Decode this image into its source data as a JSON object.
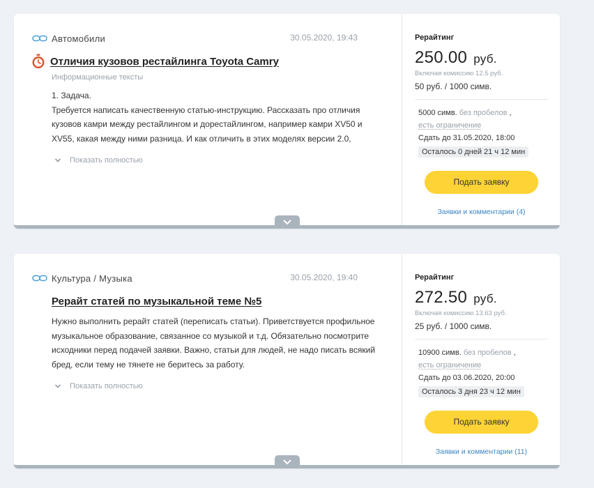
{
  "tasks": [
    {
      "category": "Автомобили",
      "date": "30.05.2020, 19:43",
      "has_timer": true,
      "title": "Отличия кузовов рестайлинга Toyota Camry",
      "subtype": "Информационные тексты",
      "description": "1. Задача.\nТребуется написать качественную статью-инструкцию. Рассказать про отличия кузовов камри между рестайлингом и дорестайлингом, например камри XV50 и XV55, какая между ними разница. И как отличить в этих моделях версии 2.0,",
      "expand_label": "Показать полностью",
      "rating_label": "Рерайтинг",
      "price": "250.00",
      "currency": "руб.",
      "commission": "Включая комиссию 12.5 руб.",
      "rate": "50 руб. / 1000 симв.",
      "symbols": "5000 симв.",
      "symbols_note": "без пробелов",
      "symbols_sep": ",",
      "limit": "есть ограничение",
      "deadline": "Сдать до 31.05.2020, 18:00",
      "remaining": "Осталось 0 дней 21 ч 12 мин",
      "apply_label": "Подать заявку",
      "comments_label": "Заявки и комментарии (4)"
    },
    {
      "category": "Культура / Музыка",
      "date": "30.05.2020, 19:40",
      "has_timer": false,
      "title": "Рерайт статей по музыкальной теме №5",
      "subtype": "",
      "description": "Нужно выполнить рерайт статей (переписать статьи). Приветствуется профильное музыкальное образование, связанное со музыкой и т.д. Обязательно посмотрите исходники перед подачей заявки. Важно, статьи для людей, не надо писать всякий бред, если тему не тянете не беритесь за работу.",
      "expand_label": "Показать полностью",
      "rating_label": "Рерайтинг",
      "price": "272.50",
      "currency": "руб.",
      "commission": "Включая комиссию 13.63 руб.",
      "rate": "25 руб. / 1000 симв.",
      "symbols": "10900 симв.",
      "symbols_note": "без пробелов",
      "symbols_sep": ",",
      "limit": "есть ограничение",
      "deadline": "Сдать до 03.06.2020, 20:00",
      "remaining": "Осталось 3 дня 23 ч 12 мин",
      "apply_label": "Подать заявку",
      "comments_label": "Заявки и комментарии (11)"
    }
  ],
  "colors": {
    "accent_button": "#fdd335",
    "link": "#3b85c4",
    "link_icon": "#4a9fd8",
    "timer_icon": "#d9552e",
    "muted": "#9aa2aa",
    "card_border": "#aab4bd"
  }
}
